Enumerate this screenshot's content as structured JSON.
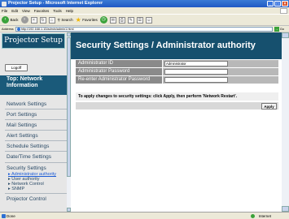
{
  "window": {
    "title": "Projector Setup - Microsoft Internet Explorer"
  },
  "menu": [
    "File",
    "Edit",
    "View",
    "Favorites",
    "Tools",
    "Help"
  ],
  "toolbar": {
    "back": "Back",
    "search": "Search",
    "favorites": "Favorites"
  },
  "address": {
    "label": "Address",
    "url": "http://192.168.1.10/admin/admin1.html",
    "go": "Go"
  },
  "sidebar": {
    "logo": "Projector Setup",
    "logoff": "Logoff",
    "header": "Top: Network Information",
    "items": [
      "Network Settings",
      "Port Settings",
      "Mail Settings",
      "Alert Settings",
      "Schedule Settings",
      "Date/Time Settings",
      "Security Settings"
    ],
    "security_sub": [
      "Administrator authority",
      "User authority",
      "Network Control",
      "SNMP"
    ],
    "projector_control": "Projector Control"
  },
  "main": {
    "title": "Security Settings / Administrator authority",
    "fields": [
      {
        "label": "Administrator ID",
        "value": "Administrator"
      },
      {
        "label": "Administrator Password",
        "value": ""
      },
      {
        "label": "Re-enter Administrator Password",
        "value": ""
      }
    ],
    "note": "To apply changes to security settings: click Apply, then perform 'Network Restart'.",
    "apply": "Apply"
  },
  "status": {
    "left": "Done",
    "zone": "Internet"
  }
}
